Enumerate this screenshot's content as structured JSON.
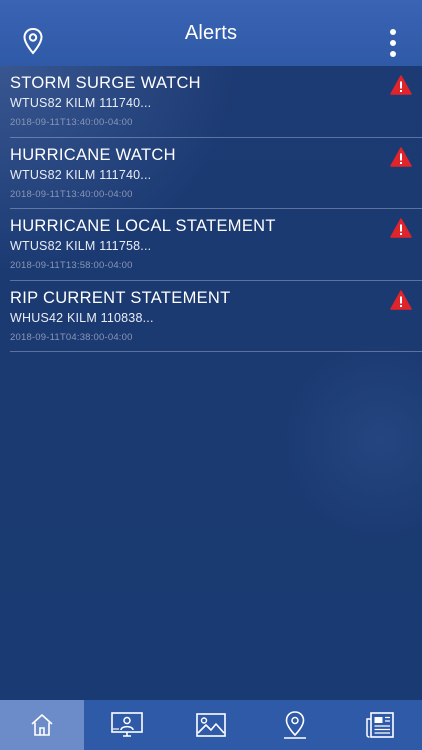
{
  "header": {
    "title": "Alerts",
    "left_icon": "location-pin-icon",
    "right_icon": "more-vertical-icon"
  },
  "alerts": [
    {
      "title": "STORM SURGE WATCH",
      "code": "WTUS82 KILM 111740...",
      "timestamp": "2018-09-11T13:40:00-04:00",
      "icon": "warning-icon"
    },
    {
      "title": "HURRICANE WATCH",
      "code": "WTUS82 KILM 111740...",
      "timestamp": "2018-09-11T13:40:00-04:00",
      "icon": "warning-icon"
    },
    {
      "title": "HURRICANE LOCAL STATEMENT",
      "code": "WTUS82 KILM 111758...",
      "timestamp": "2018-09-11T13:58:00-04:00",
      "icon": "warning-icon"
    },
    {
      "title": "RIP CURRENT STATEMENT",
      "code": "WHUS42 KILM 110838...",
      "timestamp": "2018-09-11T04:38:00-04:00",
      "icon": "warning-icon"
    }
  ],
  "tabbar": {
    "tabs": [
      {
        "icon": "home-icon",
        "active": true
      },
      {
        "icon": "video-monitor-icon",
        "active": false
      },
      {
        "icon": "image-icon",
        "active": false
      },
      {
        "icon": "map-pin-icon",
        "active": false
      },
      {
        "icon": "newspaper-icon",
        "active": false
      }
    ]
  },
  "colors": {
    "header_bg": "#2f5aa7",
    "body_bg": "#1b3a72",
    "warning_red": "#e0242b",
    "active_tab_bg": "#6b8cc8",
    "timestamp_text": "#8a97b5"
  }
}
